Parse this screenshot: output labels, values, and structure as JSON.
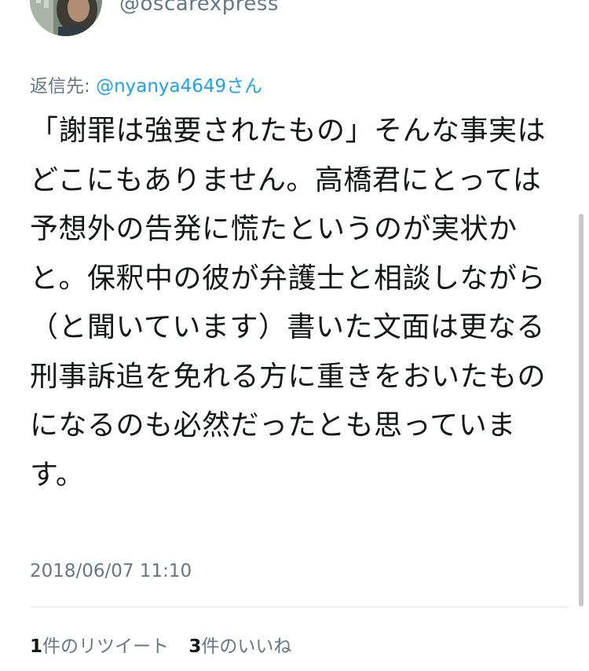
{
  "author": {
    "handle": "@oscarexpress"
  },
  "reply": {
    "prefix": "返信先: ",
    "target": "@nyanya4649さん"
  },
  "tweet": {
    "text": "「謝罪は強要されたもの」そんな事実はどこにもありません。高橋君にとっては予想外の告発に慌たというのが実状かと。保釈中の彼が弁護士と相談しながら（と聞いています）書いた文面は更なる刑事訴追を免れる方に重きをおいたものになるのも必然だったとも思っています。",
    "timestamp": "2018/06/07 11:10"
  },
  "stats": {
    "retweets_count": "1",
    "retweets_label": "件のリツイート",
    "likes_count": "3",
    "likes_label": "件のいいね"
  },
  "colors": {
    "text": "#14171a",
    "secondary": "#657786",
    "link": "#1da1f2",
    "divider": "#e1e8ed"
  },
  "icons": {
    "avatar": "profile-photo"
  }
}
